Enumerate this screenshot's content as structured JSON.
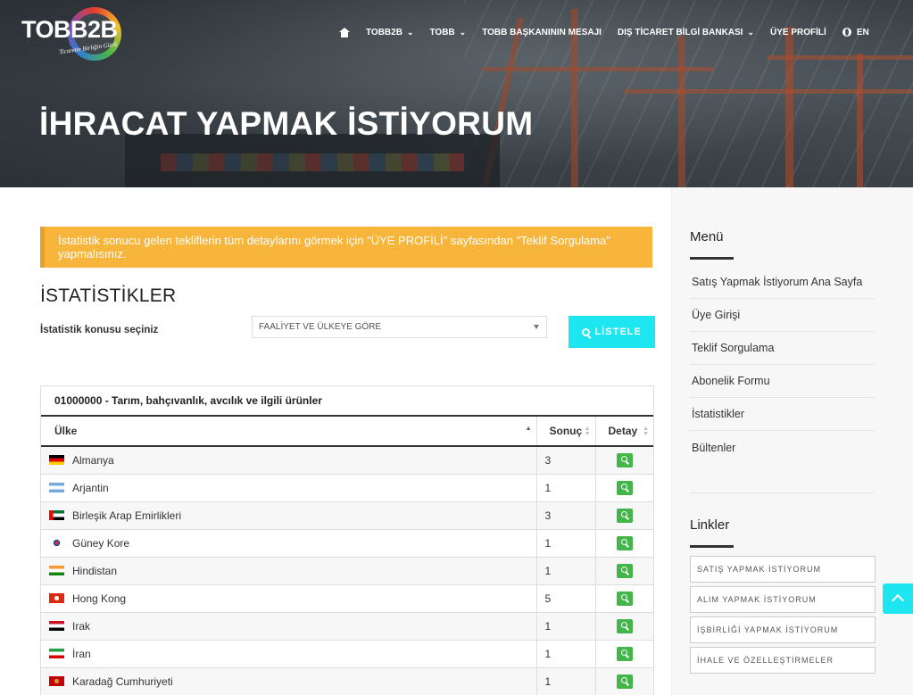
{
  "logo": {
    "text": "TOBB2B",
    "tagline": "Ticarette Birliğin Gücü"
  },
  "nav": {
    "items": [
      {
        "label": "TOBB2B"
      },
      {
        "label": "TOBB"
      },
      {
        "label": "TOBB BAŞKANININ MESAJI"
      },
      {
        "label": "DIŞ TİCARET BİLGİ BANKASI"
      },
      {
        "label": "ÜYE PROFİLİ"
      }
    ],
    "language": "EN"
  },
  "hero": {
    "title": "İHRACAT YAPMAK İSTİYORUM"
  },
  "alert": {
    "text": "İstatistik sonucu gelen tekliflerin tüm detaylarını görmek için \"ÜYE PROFİLİ\" sayfasından \"Teklif Sorgulama\" yapmalısınız."
  },
  "stats": {
    "title": "İSTATİSTİKLER",
    "select_label": "İstatistik konusu seçiniz",
    "select_value": "FAALİYET VE ÜLKEYE GÖRE",
    "list_button": "LİSTELE"
  },
  "table": {
    "caption": "01000000 - Tarım, bahçıvanlık, avcılık ve ilgili ürünler",
    "headers": {
      "country": "Ülke",
      "count": "Sonuç",
      "detail": "Detay"
    },
    "rows": [
      {
        "country": "Almanya",
        "count": "3",
        "flag": "de"
      },
      {
        "country": "Arjantin",
        "count": "1",
        "flag": "ar"
      },
      {
        "country": "Birleşik Arap Emirlikleri",
        "count": "3",
        "flag": "ae"
      },
      {
        "country": "Güney Kore",
        "count": "1",
        "flag": "kr"
      },
      {
        "country": "Hindistan",
        "count": "1",
        "flag": "in"
      },
      {
        "country": "Hong Kong",
        "count": "5",
        "flag": "hk"
      },
      {
        "country": "Irak",
        "count": "1",
        "flag": "iq"
      },
      {
        "country": "İran",
        "count": "1",
        "flag": "ir"
      },
      {
        "country": "Karadağ Cumhuriyeti",
        "count": "1",
        "flag": "me"
      }
    ]
  },
  "sidebar": {
    "menu_title": "Menü",
    "menu": [
      {
        "label": "Satış Yapmak İstiyorum Ana Sayfa"
      },
      {
        "label": "Üye Girişi"
      },
      {
        "label": "Teklif Sorgulama"
      },
      {
        "label": "Abonelik Formu"
      },
      {
        "label": "İstatistikler"
      },
      {
        "label": "Bültenler"
      }
    ],
    "links_title": "Linkler",
    "links": [
      {
        "label": "SATIŞ YAPMAK İSTİYORUM"
      },
      {
        "label": "ALIM YAPMAK İSTİYORUM"
      },
      {
        "label": "İŞBİRLİĞİ YAPMAK İSTİYORUM"
      },
      {
        "label": "İHALE VE ÖZELLEŞTİRMELER"
      }
    ]
  },
  "colors": {
    "accent": "#1ee6f0",
    "alert": "#f7b53c",
    "detail_button": "#42b649"
  }
}
